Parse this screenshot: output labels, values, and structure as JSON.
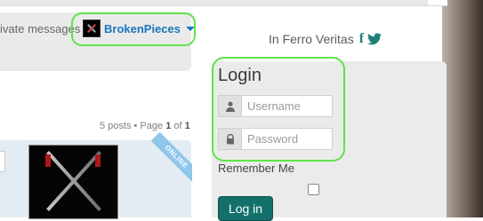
{
  "header": {
    "private_messages_label": "ivate messages",
    "username": "BrokenPieces",
    "tagline": "In Ferro Veritas",
    "social": [
      "facebook-icon",
      "twitter-icon"
    ]
  },
  "topic": {
    "posts_prefix": "5 posts • Page ",
    "page_current": "1",
    "page_of": " of ",
    "page_total": "1"
  },
  "post": {
    "status_badge": "ONLINE"
  },
  "login": {
    "title": "Login",
    "username_placeholder": "Username",
    "password_placeholder": "Password",
    "remember_label": "Remember Me",
    "remember_checked": false,
    "submit_label": "Log in"
  },
  "colors": {
    "accent": "#1b75bb",
    "brand_teal": "#14706a",
    "highlight": "#5fe34a",
    "online_ribbon": "#8fc6ea"
  }
}
